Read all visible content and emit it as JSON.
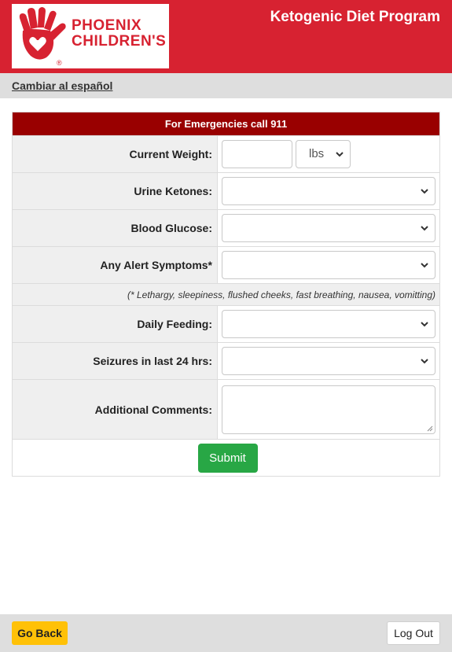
{
  "header": {
    "brand_line1": "PHOENIX",
    "brand_line2": "CHILDREN'S",
    "registered": "®",
    "app_title": "Ketogenic Diet Program",
    "brand_color": "#d72231"
  },
  "lang": {
    "link_label": "Cambiar al español"
  },
  "form": {
    "emergency_text": "For Emergencies call 911",
    "weight": {
      "label": "Current Weight:",
      "value": "",
      "unit_selected": "lbs"
    },
    "urine_ketones": {
      "label": "Urine Ketones:",
      "selected": ""
    },
    "blood_glucose": {
      "label": "Blood Glucose:",
      "selected": ""
    },
    "alert_symptoms": {
      "label": "Any Alert Symptoms*",
      "selected": ""
    },
    "symptoms_note": "(* Lethargy, sleepiness, flushed cheeks, fast breathing, nausea, vomitting)",
    "daily_feeding": {
      "label": "Daily Feeding:",
      "selected": ""
    },
    "seizures": {
      "label": "Seizures in last 24 hrs:",
      "selected": ""
    },
    "comments": {
      "label": "Additional Comments:",
      "value": ""
    },
    "submit_label": "Submit"
  },
  "footer": {
    "back_label": "Go Back",
    "logout_label": "Log Out"
  },
  "icons": {
    "logo": "hand-heart-logo",
    "dropdown": "chevron-down-icon",
    "resize": "resize-grip-icon"
  }
}
